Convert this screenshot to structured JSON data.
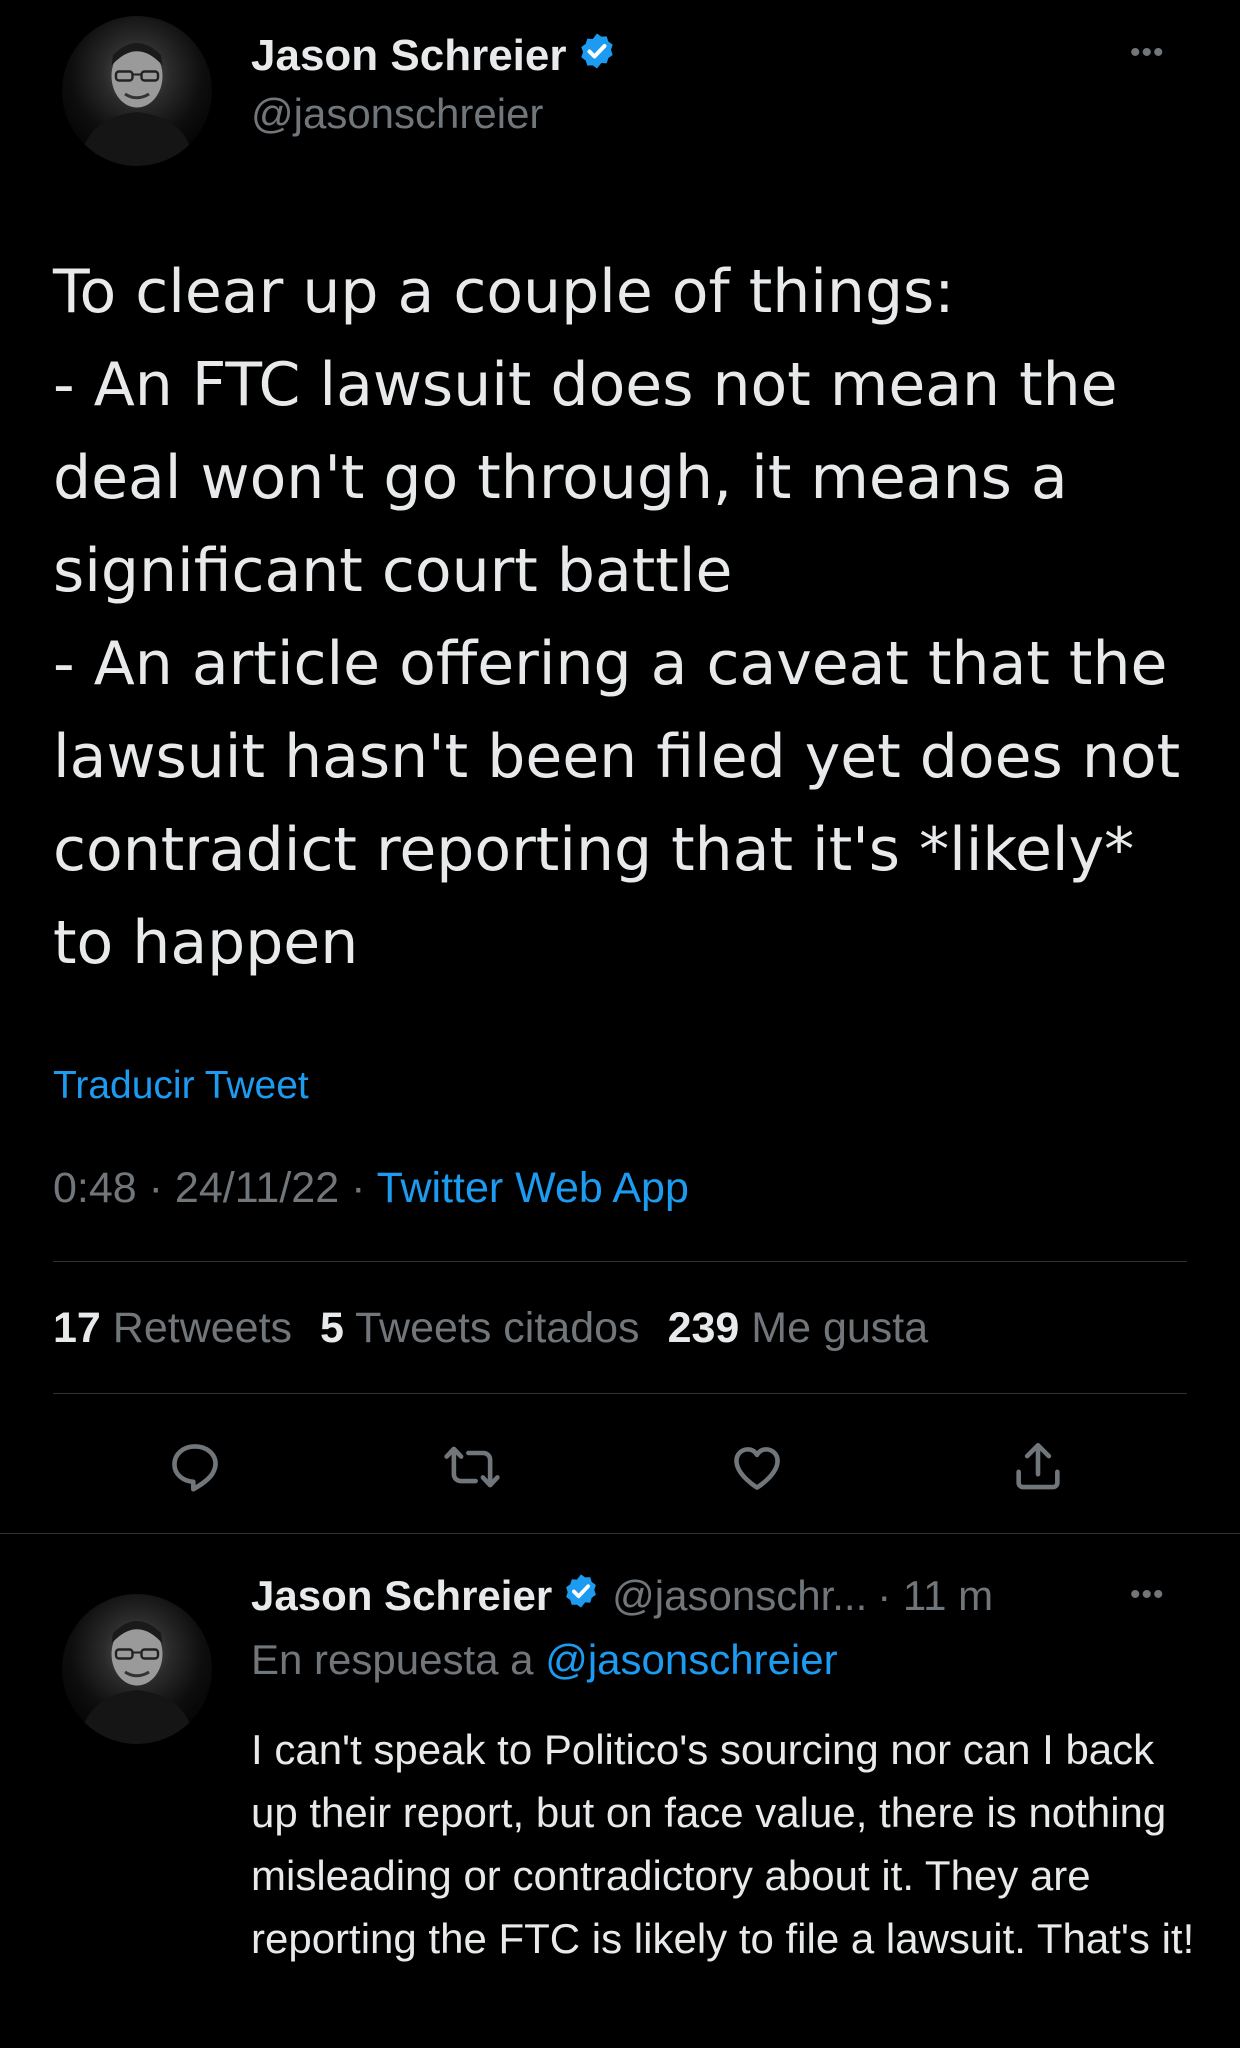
{
  "main_tweet": {
    "author_name": "Jason Schreier",
    "handle": "@jasonschreier",
    "text": "To clear up a couple of things:\n- An FTC lawsuit does not mean the deal won't go through, it means a significant court battle\n- An article offering a caveat that the lawsuit hasn't been filed yet does not contradict reporting that it's *likely* to happen",
    "translate_label": "Traducir Tweet",
    "time": "0:48",
    "date": "24/11/22",
    "source": "Twitter Web App",
    "separator": " · ",
    "stats": {
      "retweets_count": "17",
      "retweets_label": "Retweets",
      "quotes_count": "5",
      "quotes_label": "Tweets citados",
      "likes_count": "239",
      "likes_label": "Me gusta"
    }
  },
  "reply_tweet": {
    "author_name": "Jason Schreier",
    "handle_truncated": "@jasonschr...",
    "time_ago": "· 11 m",
    "replying_prefix": "En respuesta a",
    "replying_to": "@jasonschreier",
    "text": "I can't speak to Politico's sourcing nor can I back up their report, but on face value, there is nothing misleading or contradictory about it. They are reporting the FTC is likely to file a lawsuit. That's it!"
  },
  "icons": {
    "more": "more-horizontal-icon",
    "verified": "verified-badge-icon",
    "reply": "reply-icon",
    "retweet": "retweet-icon",
    "like": "like-icon",
    "share": "share-icon"
  },
  "colors": {
    "background": "#000000",
    "text_primary": "#e7e9ea",
    "text_secondary": "#71767b",
    "accent": "#1d9bf0",
    "divider": "#2f3336"
  },
  "more_glyph": "•••"
}
